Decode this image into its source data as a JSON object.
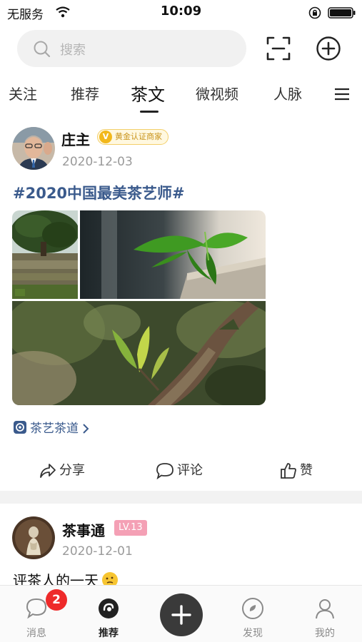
{
  "status_bar": {
    "carrier": "无服务",
    "time": "10:09"
  },
  "search": {
    "placeholder": "搜索"
  },
  "tabs": [
    {
      "label": "关注"
    },
    {
      "label": "推荐"
    },
    {
      "label": "茶文",
      "active": true
    },
    {
      "label": "微视频"
    },
    {
      "label": "人脉"
    }
  ],
  "posts": [
    {
      "author": "庄主",
      "badge": "黄金认证商家",
      "badge_icon": "V",
      "date": "2020-12-03",
      "hashtag": "#2020中国最美茶艺师#",
      "images": [
        "tea-tree-photo",
        "tea-leaf-photo",
        "tea-bud-photo"
      ],
      "topic": "茶艺茶道",
      "actions": {
        "share": "分享",
        "comment": "评论",
        "like": "赞"
      }
    },
    {
      "author": "茶事通",
      "level": "LV.13",
      "date": "2020-12-01",
      "text": "评茶人的一天"
    }
  ],
  "bottom_nav": {
    "messages": {
      "label": "消息",
      "badge": "2"
    },
    "recommend": {
      "label": "推荐"
    },
    "discover": {
      "label": "发现"
    },
    "profile": {
      "label": "我的"
    }
  },
  "colors": {
    "link_blue": "#3a5a8c",
    "gold": "#f2b81c",
    "badge_red": "#ee2a2a",
    "level_pink": "#f4a0b5"
  }
}
